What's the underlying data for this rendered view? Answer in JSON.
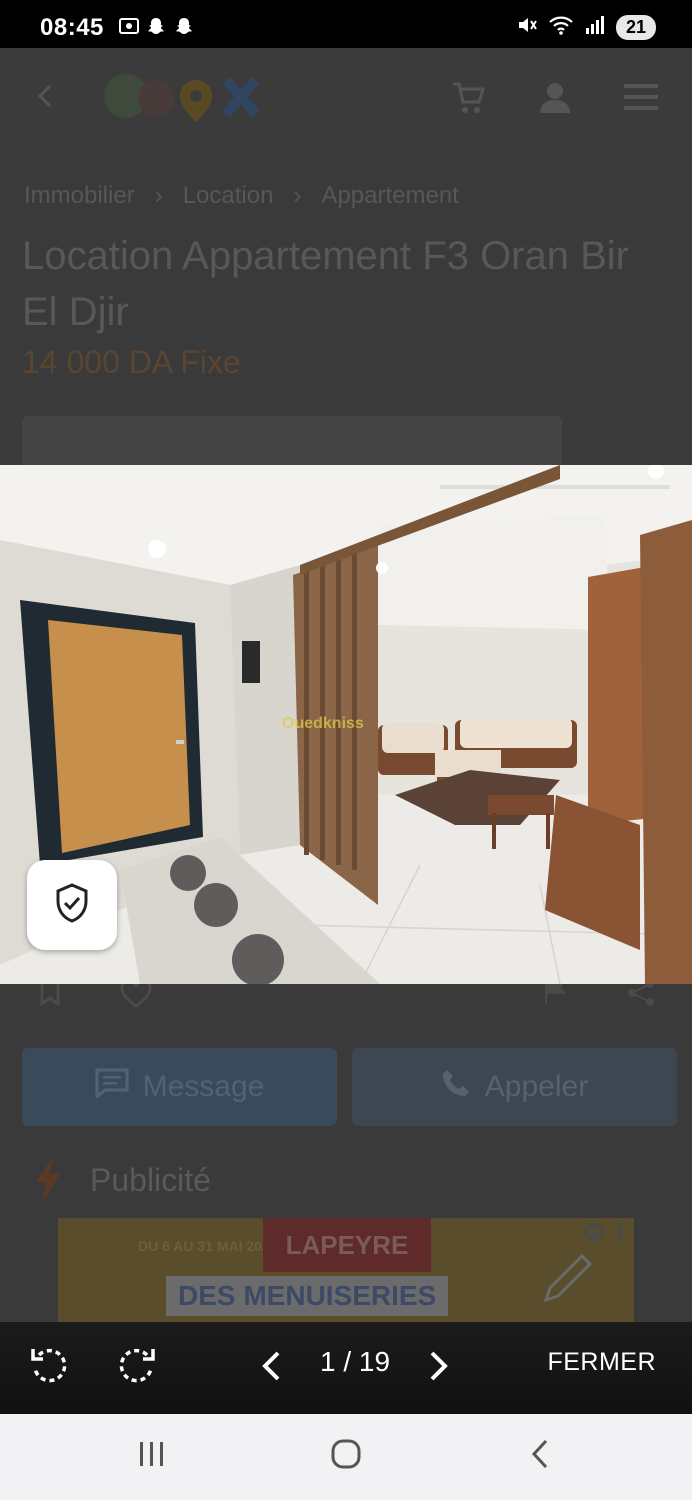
{
  "status_bar": {
    "time": "08:45",
    "battery": "21"
  },
  "page": {
    "breadcrumb": [
      "Immobilier",
      "Location",
      "Appartement"
    ],
    "title": "Location Appartement F3 Oran Bir El Djir",
    "price": "14 000 DA Fixe",
    "message_label": "Message",
    "call_label": "Appeler",
    "ad_section_label": "Publicité",
    "ad": {
      "date": "DU 6 AU 31 MAI 2023",
      "brand": "LAPEYRE",
      "headline": "DES MENUISERIES"
    }
  },
  "photo": {
    "watermark": "Ouedkniss"
  },
  "viewer": {
    "counter": "1 / 19",
    "close_label": "FERMER"
  },
  "colors": {
    "accent_blue": "#1c6dd0",
    "price_orange": "#e0862b",
    "door_wood": "#c68f4c"
  }
}
